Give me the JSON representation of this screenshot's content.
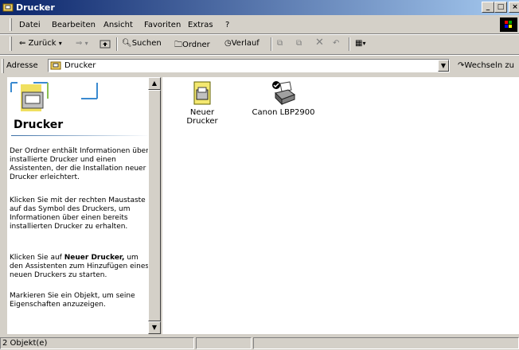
{
  "window": {
    "title": "Drucker"
  },
  "menu": [
    "Datei",
    "Bearbeiten",
    "Ansicht",
    "Favoriten",
    "Extras",
    "?"
  ],
  "toolbar": {
    "back": "Zurück",
    "search": "Suchen",
    "folders": "Ordner",
    "history": "Verlauf"
  },
  "address": {
    "label": "Adresse",
    "value": "Drucker",
    "go": "Wechseln zu"
  },
  "leftpane": {
    "title": "Drucker",
    "para1": "Der Ordner enthält Informationen über installierte Drucker und einen Assistenten, der die Installation neuer Drucker erleichtert.",
    "para2": "Klicken Sie mit der rechten Maustaste auf das Symbol des Druckers, um Informationen über einen bereits installierten Drucker zu erhalten.",
    "para3_pre": "Klicken Sie auf ",
    "para3_bold": "Neuer Drucker,",
    "para3_post": " um den Assistenten zum Hinzufügen eines neuen Druckers zu starten.",
    "para4": "Markieren Sie ein Objekt, um seine Eigenschaften anzuzeigen."
  },
  "items": [
    {
      "label": "Neuer Drucker",
      "icon": "add-printer-icon"
    },
    {
      "label": "Canon LBP2900",
      "icon": "printer-icon"
    }
  ],
  "status": {
    "count": "2 Objekt(e)"
  }
}
